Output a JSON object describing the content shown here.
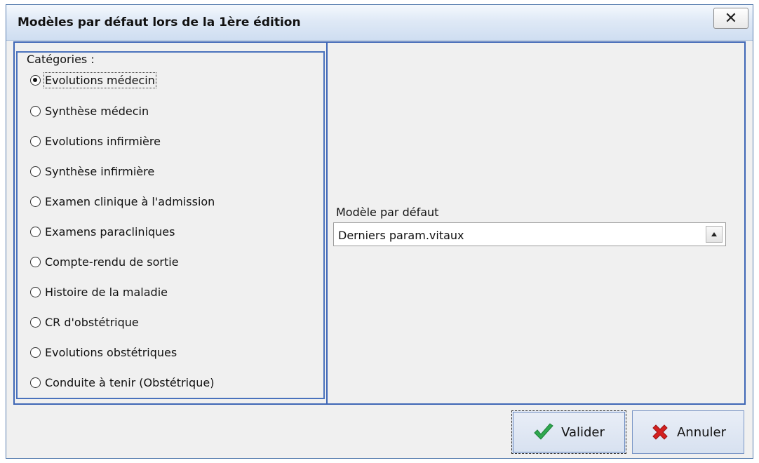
{
  "window": {
    "title": "Modèles par défaut lors de la 1ère édition",
    "close_label": "✕"
  },
  "categories": {
    "legend": "Catégories :",
    "items": [
      {
        "label": "Evolutions médecin",
        "checked": true
      },
      {
        "label": "Synthèse médecin",
        "checked": false
      },
      {
        "label": "Evolutions infirmière",
        "checked": false
      },
      {
        "label": "Synthèse infirmière",
        "checked": false
      },
      {
        "label": "Examen clinique à l'admission",
        "checked": false
      },
      {
        "label": "Examens paracliniques",
        "checked": false
      },
      {
        "label": "Compte-rendu de sortie",
        "checked": false
      },
      {
        "label": "Histoire de la maladie",
        "checked": false
      },
      {
        "label": "CR d'obstétrique",
        "checked": false
      },
      {
        "label": "Evolutions obstétriques",
        "checked": false
      },
      {
        "label": "Conduite à tenir (Obstétrique)",
        "checked": false
      }
    ]
  },
  "default_model": {
    "label": "Modèle par défaut",
    "value": "Derniers param.vitaux"
  },
  "buttons": {
    "validate_label": "Valider",
    "validate_icon": "check-icon",
    "cancel_label": "Annuler",
    "cancel_icon": "cross-icon"
  },
  "colors": {
    "accent_border": "#3f67b6",
    "check_green": "#2fa84f",
    "cross_red": "#d42020"
  }
}
